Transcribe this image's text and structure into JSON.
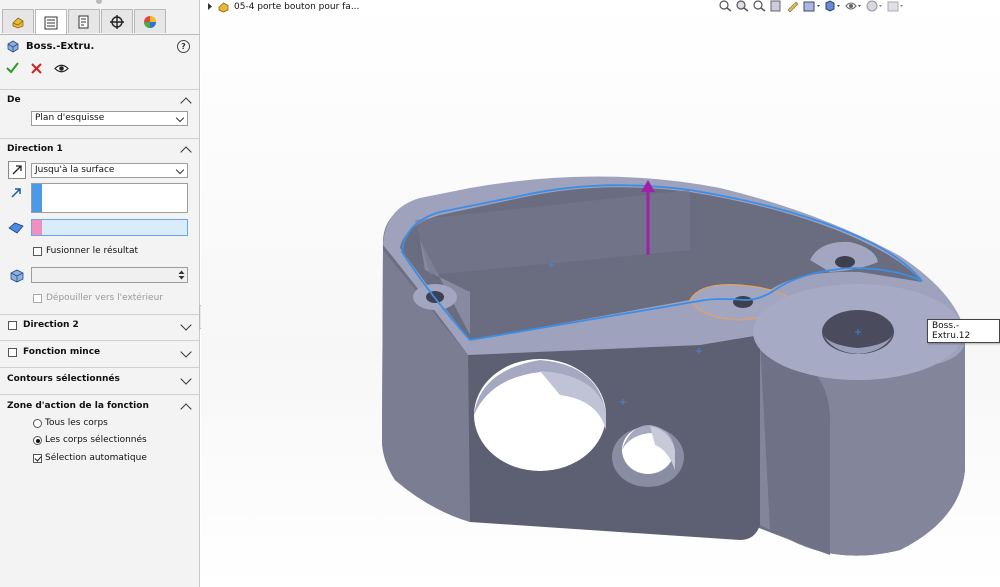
{
  "document": {
    "title": "05-4 porte bouton pour fa..."
  },
  "feature": {
    "title": "Boss.-Extru.",
    "help": "?"
  },
  "sections": {
    "from": {
      "title": "De",
      "start_condition": "Plan d'esquisse"
    },
    "direction1": {
      "title": "Direction 1",
      "end_condition": "Jusqu'à la surface",
      "merge_label": "Fusionner le résultat",
      "merge_checked": false,
      "draft_label": "Dépouiller vers l'extérieur"
    },
    "direction2": {
      "title": "Direction 2"
    },
    "thin": {
      "title": "Fonction mince"
    },
    "contours": {
      "title": "Contours sélectionnés"
    },
    "scope": {
      "title": "Zone d'action de la fonction",
      "all_bodies": "Tous les corps",
      "selected_bodies": "Les corps sélectionnés",
      "auto_select": "Sélection automatique",
      "selected_option": "selected_bodies",
      "auto_select_checked": true
    }
  },
  "viewport": {
    "tooltip": "Boss.-Extru.12"
  },
  "colors": {
    "part": "#7a7d8f",
    "sketch": "#3b8ee8",
    "arrow": "#a020a8",
    "highlight": "#e8a060",
    "selection_blue": "#4a9ae8",
    "selection_pink": "#f090c0"
  },
  "icons": [
    "feature-manager-icon",
    "property-manager-icon",
    "configuration-manager-icon",
    "dimxpert-icon",
    "display-manager-icon",
    "extrude-boss-icon",
    "ok-check-icon",
    "cancel-x-icon",
    "preview-eye-icon"
  ]
}
